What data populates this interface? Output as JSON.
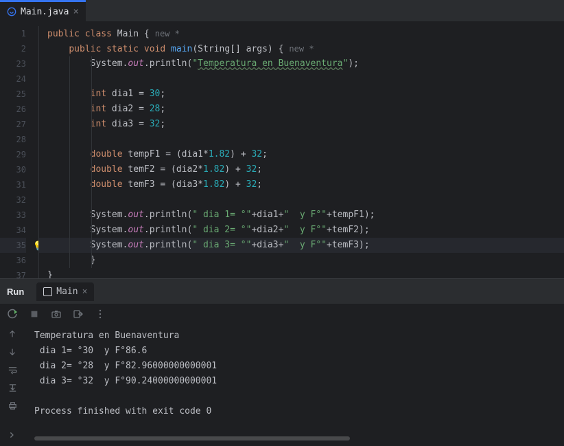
{
  "tab": {
    "filename": "Main.java"
  },
  "editor": {
    "hints": {
      "class": "new *",
      "method": "new *"
    },
    "firstLineNumber": 1,
    "lines": [
      {
        "n": 1,
        "tokens": [
          {
            "t": "public",
            "c": "kw"
          },
          {
            "t": " "
          },
          {
            "t": "class",
            "c": "kw"
          },
          {
            "t": " "
          },
          {
            "t": "Main",
            "c": "cls"
          },
          {
            "t": " {"
          }
        ],
        "hint": "class",
        "indent": 0
      },
      {
        "n": 2,
        "tokens": [
          {
            "t": "    "
          },
          {
            "t": "public",
            "c": "kw"
          },
          {
            "t": " "
          },
          {
            "t": "static",
            "c": "kw"
          },
          {
            "t": " "
          },
          {
            "t": "void",
            "c": "kw"
          },
          {
            "t": " "
          },
          {
            "t": "main",
            "c": "mth"
          },
          {
            "t": "(String[] args) {"
          }
        ],
        "hint": "method",
        "indent": 0
      },
      {
        "n": 23,
        "tokens": [
          {
            "t": "        System."
          },
          {
            "t": "out",
            "c": "field"
          },
          {
            "t": ".println("
          },
          {
            "t": "\"",
            "c": "str"
          },
          {
            "t": "Temperatura en Buenaventura",
            "c": "str underline"
          },
          {
            "t": "\"",
            "c": "str"
          },
          {
            "t": ");"
          }
        ],
        "indent": 2
      },
      {
        "n": 24,
        "tokens": [],
        "indent": 2
      },
      {
        "n": 25,
        "tokens": [
          {
            "t": "        "
          },
          {
            "t": "int",
            "c": "kw"
          },
          {
            "t": " dia1 = "
          },
          {
            "t": "30",
            "c": "num"
          },
          {
            "t": ";"
          }
        ],
        "indent": 2
      },
      {
        "n": 26,
        "tokens": [
          {
            "t": "        "
          },
          {
            "t": "int",
            "c": "kw"
          },
          {
            "t": " dia2 = "
          },
          {
            "t": "28",
            "c": "num"
          },
          {
            "t": ";"
          }
        ],
        "indent": 2
      },
      {
        "n": 27,
        "tokens": [
          {
            "t": "        "
          },
          {
            "t": "int",
            "c": "kw"
          },
          {
            "t": " dia3 = "
          },
          {
            "t": "32",
            "c": "num"
          },
          {
            "t": ";"
          }
        ],
        "indent": 2
      },
      {
        "n": 28,
        "tokens": [],
        "indent": 2
      },
      {
        "n": 29,
        "tokens": [
          {
            "t": "        "
          },
          {
            "t": "double",
            "c": "kw"
          },
          {
            "t": " tempF1 = (dia1*"
          },
          {
            "t": "1.82",
            "c": "num"
          },
          {
            "t": ") + "
          },
          {
            "t": "32",
            "c": "num"
          },
          {
            "t": ";"
          }
        ],
        "indent": 2
      },
      {
        "n": 30,
        "tokens": [
          {
            "t": "        "
          },
          {
            "t": "double",
            "c": "kw"
          },
          {
            "t": " temF2 = (dia2*"
          },
          {
            "t": "1.82",
            "c": "num"
          },
          {
            "t": ") + "
          },
          {
            "t": "32",
            "c": "num"
          },
          {
            "t": ";"
          }
        ],
        "indent": 2
      },
      {
        "n": 31,
        "tokens": [
          {
            "t": "        "
          },
          {
            "t": "double",
            "c": "kw"
          },
          {
            "t": " temF3 = (dia3*"
          },
          {
            "t": "1.82",
            "c": "num"
          },
          {
            "t": ") + "
          },
          {
            "t": "32",
            "c": "num"
          },
          {
            "t": ";"
          }
        ],
        "indent": 2
      },
      {
        "n": 32,
        "tokens": [],
        "indent": 2
      },
      {
        "n": 33,
        "tokens": [
          {
            "t": "        System."
          },
          {
            "t": "out",
            "c": "field"
          },
          {
            "t": ".println("
          },
          {
            "t": "\" dia 1= °\"",
            "c": "str"
          },
          {
            "t": "+dia1+"
          },
          {
            "t": "\"  y F°\"",
            "c": "str"
          },
          {
            "t": "+tempF1);"
          }
        ],
        "indent": 2
      },
      {
        "n": 34,
        "tokens": [
          {
            "t": "        System."
          },
          {
            "t": "out",
            "c": "field"
          },
          {
            "t": ".println("
          },
          {
            "t": "\" dia 2= °\"",
            "c": "str"
          },
          {
            "t": "+dia2+"
          },
          {
            "t": "\"  y F°\"",
            "c": "str"
          },
          {
            "t": "+temF2);"
          }
        ],
        "indent": 2
      },
      {
        "n": 35,
        "hl": true,
        "bulb": true,
        "tokens": [
          {
            "t": "        System."
          },
          {
            "t": "out",
            "c": "field"
          },
          {
            "t": ".println("
          },
          {
            "t": "\" dia 3= °\"",
            "c": "str"
          },
          {
            "t": "+dia3+"
          },
          {
            "t": "\"  y F°\"",
            "c": "str"
          },
          {
            "t": "+temF3);"
          }
        ],
        "indent": 2
      },
      {
        "n": 36,
        "tokens": [
          {
            "t": "        }"
          }
        ],
        "indent": 2
      },
      {
        "n": 37,
        "tokens": [
          {
            "t": "}"
          }
        ],
        "indent": 0
      }
    ]
  },
  "run": {
    "panelTitle": "Run",
    "tabName": "Main",
    "output": [
      "Temperatura en Buenaventura",
      " dia 1= °30  y F°86.6",
      " dia 2= °28  y F°82.96000000000001",
      " dia 3= °32  y F°90.24000000000001",
      "",
      "Process finished with exit code 0"
    ]
  }
}
